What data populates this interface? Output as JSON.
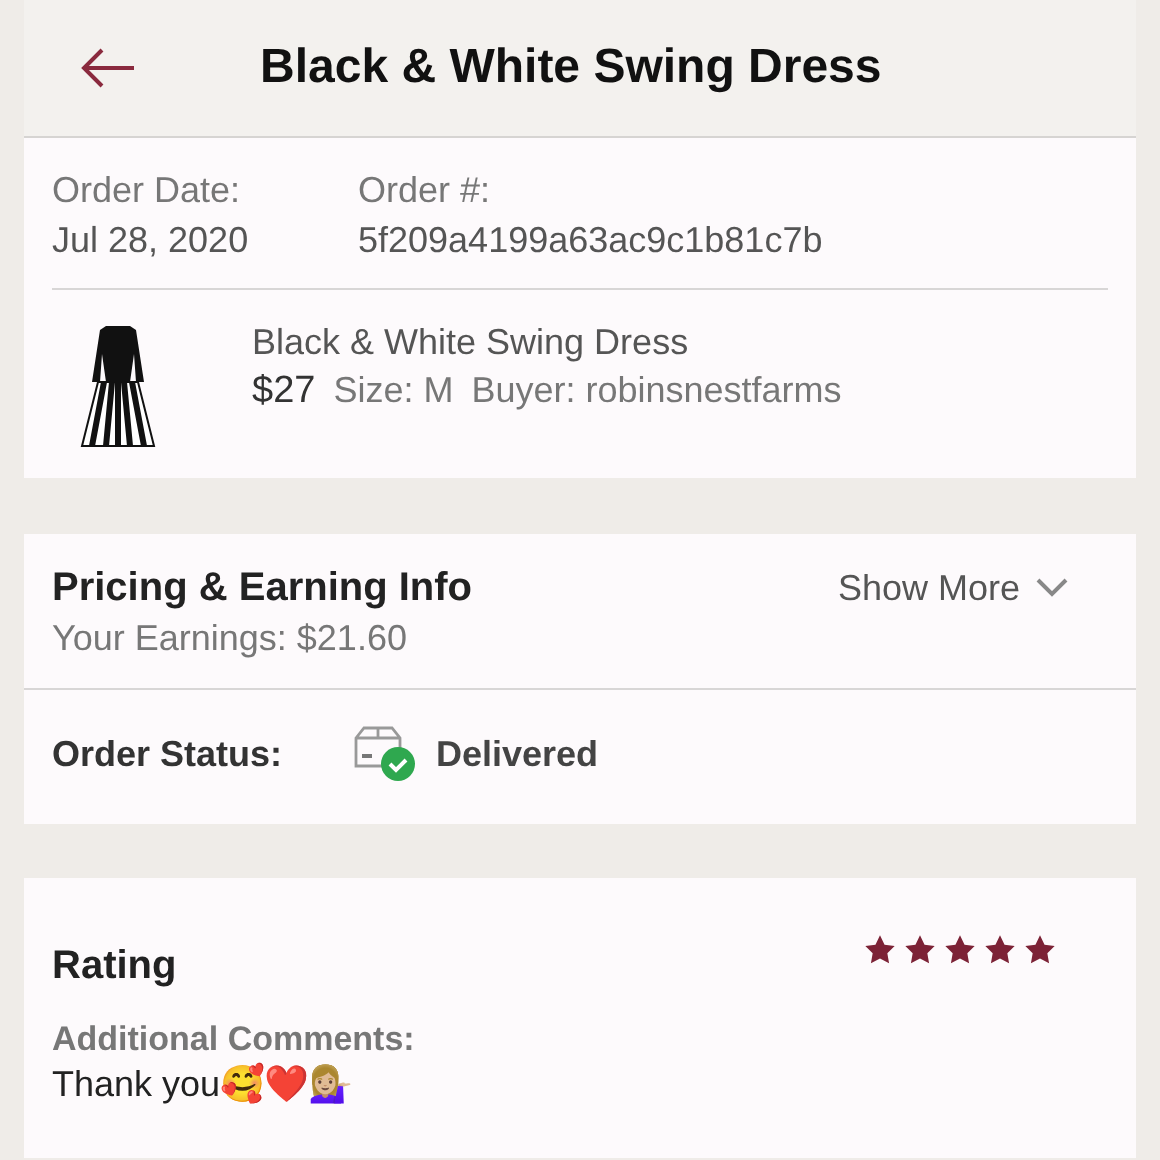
{
  "header": {
    "title": "Black & White Swing Dress"
  },
  "order": {
    "date_label": "Order Date:",
    "date": "Jul 28, 2020",
    "number_label": "Order #:",
    "number": "5f209a4199a63ac9c1b81c7b"
  },
  "item": {
    "title": "Black & White Swing Dress",
    "price": "$27",
    "size": "Size: M",
    "buyer": "Buyer: robinsnestfarms"
  },
  "pricing": {
    "title": "Pricing & Earning Info",
    "earnings": "Your Earnings: $21.60",
    "toggle": "Show More",
    "expanded": false
  },
  "status": {
    "label": "Order Status:",
    "value": "Delivered"
  },
  "rating": {
    "title": "Rating",
    "stars": 5,
    "comments_label": "Additional Comments:",
    "comment": "Thank you🥰❤️💁🏼‍♀️"
  }
}
